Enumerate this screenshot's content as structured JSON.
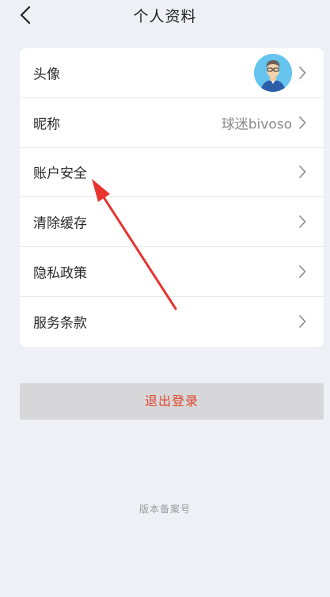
{
  "header": {
    "title": "个人资料"
  },
  "rows": [
    {
      "label": "头像",
      "value": ""
    },
    {
      "label": "昵称",
      "value": "球迷bivoso"
    },
    {
      "label": "账户安全",
      "value": ""
    },
    {
      "label": "清除缓存",
      "value": ""
    },
    {
      "label": "隐私政策",
      "value": ""
    },
    {
      "label": "服务条款",
      "value": ""
    }
  ],
  "logout": {
    "label": "退出登录"
  },
  "footer": {
    "text": "版本备案号"
  },
  "colors": {
    "background": "#eef0f6",
    "card": "#ffffff",
    "logout_text": "#e0452c",
    "logout_bg": "#d7d7d9",
    "annotation_arrow": "#e8332e"
  },
  "icons": {
    "back": "chevron-left-icon",
    "row_arrow": "chevron-right-icon",
    "avatar": "user-avatar-icon"
  }
}
